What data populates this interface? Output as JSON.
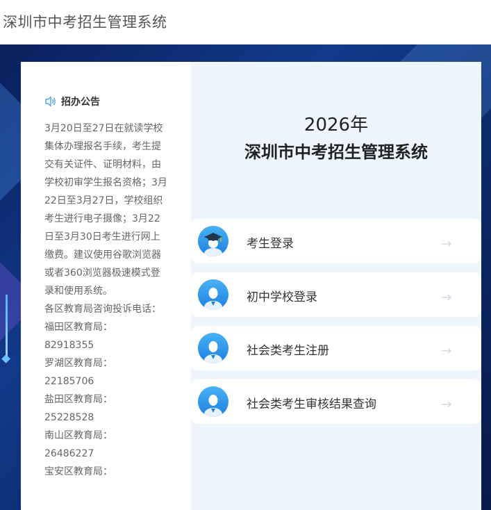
{
  "header": {
    "title": "深圳市中考招生管理系统"
  },
  "notice": {
    "title": "招办公告",
    "lines": [
      "3月20日至27日在就读学校集体办理报名手续，考生提交有关证件、证明材料，由学校初审学生报名资格；3月22日至3月27日，学校组织考生进行电子摄像；3月22日至3月30日考生进行网上缴费。建议使用谷歌浏览器或者360浏览器极速模式登录和使用系统。",
      "各区教育局咨询投诉电话：",
      "福田区教育局：",
      "82918355",
      "罗湖区教育局：",
      "22185706",
      "盐田区教育局：",
      "25228528",
      "南山区教育局：",
      "26486227",
      "宝安区教育局："
    ]
  },
  "main": {
    "year": "2026年",
    "system_name": "深圳市中考招生管理系统",
    "entries": [
      {
        "label": "考生登录",
        "icon": "graduate-cap-icon"
      },
      {
        "label": "初中学校登录",
        "icon": "person-icon"
      },
      {
        "label": "社会类考生注册",
        "icon": "person-icon"
      },
      {
        "label": "社会类考生审核结果查询",
        "icon": "person-icon"
      }
    ]
  },
  "colors": {
    "accent_blue": "#1c7fe0",
    "right_pane_bg": "#eef5fd",
    "background_navy": "#0c2a6a"
  }
}
